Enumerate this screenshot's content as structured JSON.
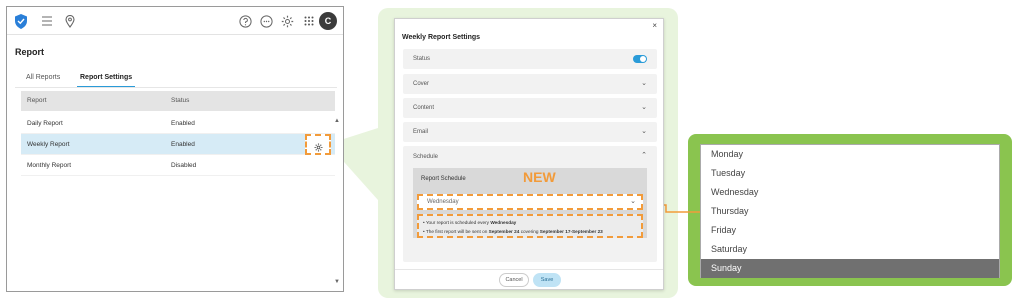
{
  "app": {
    "avatar_initial": "C",
    "page_title": "Report",
    "tabs": [
      {
        "label": "All Reports"
      },
      {
        "label": "Report Settings"
      }
    ],
    "table": {
      "headers": {
        "report": "Report",
        "status": "Status"
      },
      "rows": [
        {
          "report": "Daily Report",
          "status": "Enabled"
        },
        {
          "report": "Weekly Report",
          "status": "Enabled"
        },
        {
          "report": "Monthly Report",
          "status": "Disabled"
        }
      ]
    }
  },
  "dialog": {
    "title": "Weekly Report Settings",
    "close_glyph": "×",
    "sections": {
      "status": "Status",
      "cover": "Cover",
      "content": "Content",
      "email": "Email",
      "schedule": "Schedule"
    },
    "status_enabled": true,
    "report_schedule_label": "Report Schedule",
    "new_badge": "NEW",
    "selected_day": "Wednesday",
    "notes": {
      "line1_prefix": "• Your report is scheduled every ",
      "line1_day": "Wednesday",
      "line2_prefix": "• The first report will be sent on ",
      "line2_date": "September 24",
      "line2_mid": " covering ",
      "line2_range": "September 17-September 23"
    },
    "cancel_label": "Cancel",
    "save_label": "Save"
  },
  "dropdown": {
    "options": [
      {
        "label": "Monday"
      },
      {
        "label": "Tuesday"
      },
      {
        "label": "Wednesday"
      },
      {
        "label": "Thursday"
      },
      {
        "label": "Friday"
      },
      {
        "label": "Saturday"
      },
      {
        "label": "Sunday"
      }
    ],
    "highlighted": "Sunday"
  },
  "colors": {
    "accent": "#2a9bd8",
    "highlight_dash": "#f29b3a",
    "callout_light_green": "#e8f4dd",
    "callout_green": "#8ac44f",
    "selected_row": "#d6ebf6",
    "selected_option": "#707070"
  },
  "icons": [
    "shield-logo-icon",
    "hamburger-menu-icon",
    "location-pin-icon",
    "help-icon",
    "chat-icon",
    "gear-icon",
    "apps-grid-icon",
    "chevron-down-icon",
    "chevron-up-icon",
    "close-icon"
  ]
}
